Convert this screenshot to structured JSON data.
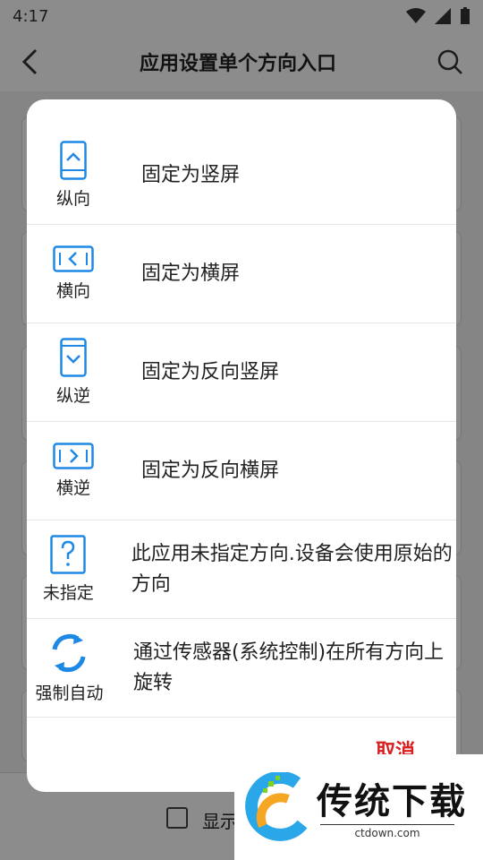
{
  "status": {
    "time": "4:17"
  },
  "appbar": {
    "title": "应用设置单个方向入口"
  },
  "options": [
    {
      "icon": "portrait-phone-icon",
      "label": "纵向",
      "description": "固定为竖屏"
    },
    {
      "icon": "landscape-phone-icon",
      "label": "横向",
      "description": "固定为横屏"
    },
    {
      "icon": "reverse-portrait-phone-icon",
      "label": "纵逆",
      "description": "固定为反向竖屏"
    },
    {
      "icon": "reverse-landscape-phone-icon",
      "label": "横逆",
      "description": "固定为反向横屏"
    },
    {
      "icon": "question-phone-icon",
      "label": "未指定",
      "description": "此应用未指定方向.设备会使用原始的方向"
    },
    {
      "icon": "auto-rotate-icon",
      "label": "强制自动",
      "description": "通过传感器(系统控制)在所有方向上旋转"
    }
  ],
  "dialog": {
    "cancel_label": "取消"
  },
  "bottom": {
    "checkbox_label": "显示"
  },
  "watermark": {
    "brand": "传统下载",
    "url": "ctdown.com"
  },
  "colors": {
    "accent_blue": "#1e88e5",
    "cancel_red": "#d81e1e"
  }
}
